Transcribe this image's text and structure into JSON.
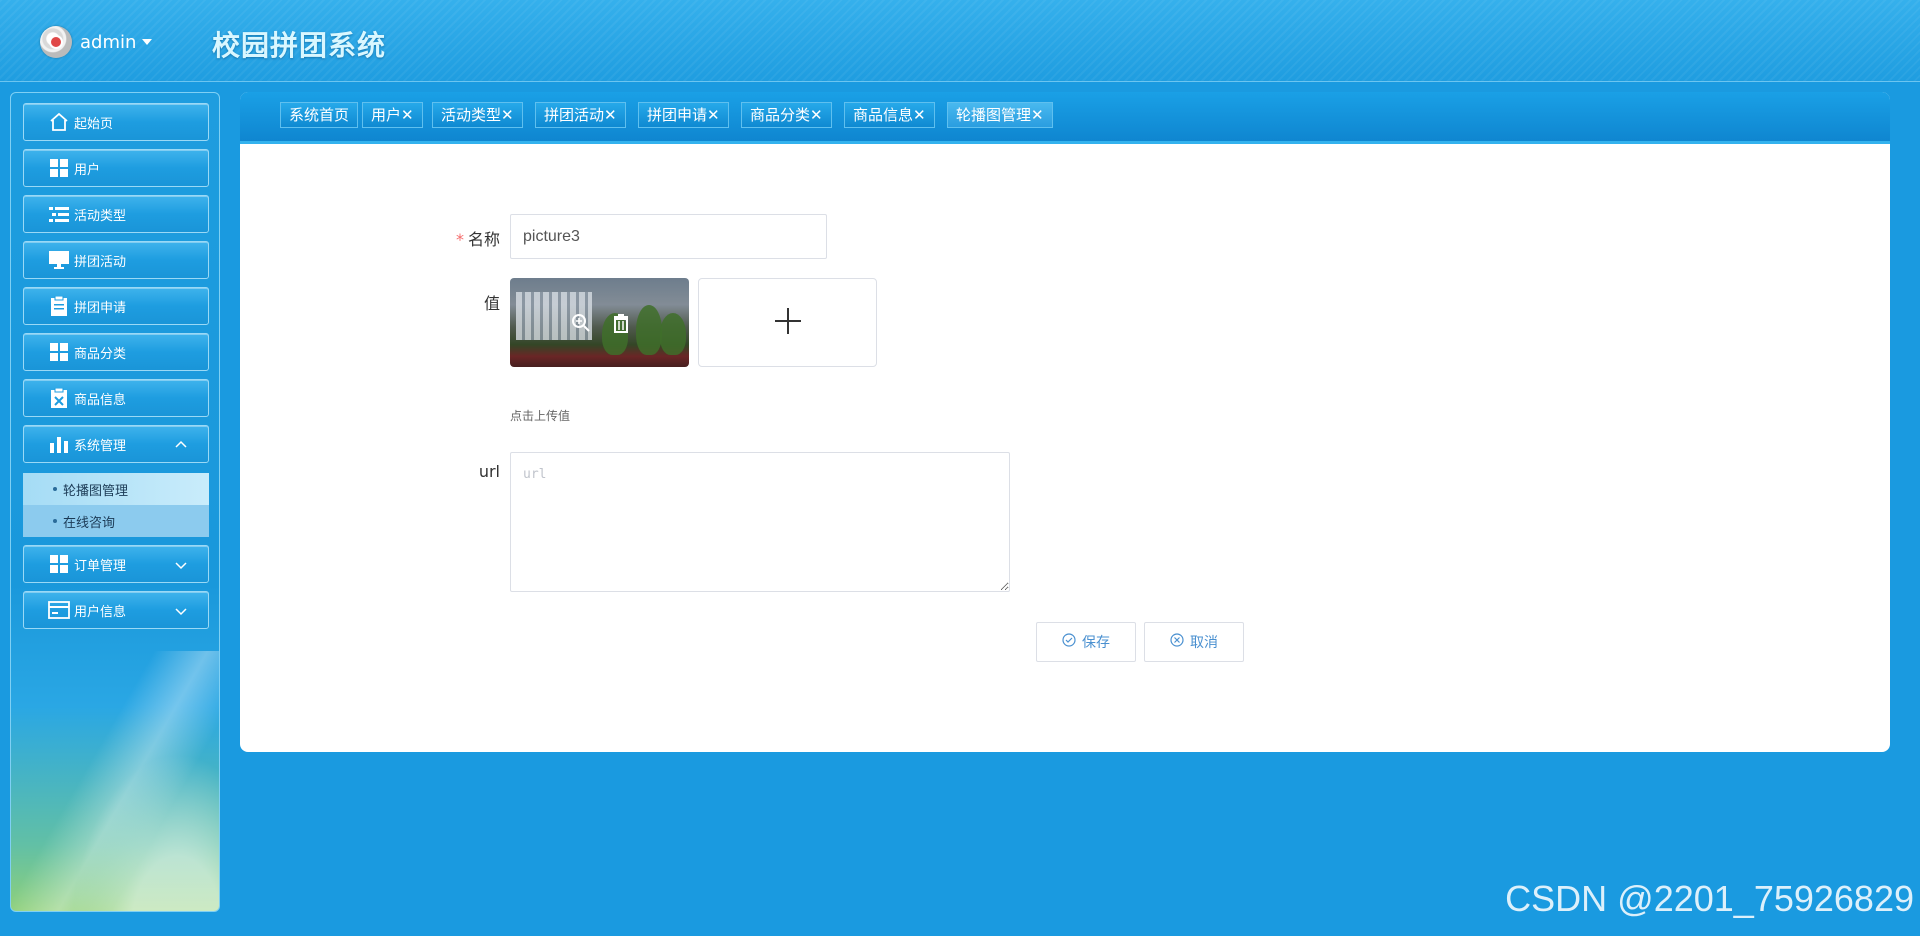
{
  "header": {
    "username": "admin",
    "app_title": "校园拼团系统"
  },
  "sidebar": {
    "items": [
      {
        "label": "起始页",
        "icon": "home-icon"
      },
      {
        "label": "用户",
        "icon": "grid-icon"
      },
      {
        "label": "活动类型",
        "icon": "list-icon"
      },
      {
        "label": "拼团活动",
        "icon": "monitor-icon"
      },
      {
        "label": "拼团申请",
        "icon": "clipboard-icon"
      },
      {
        "label": "商品分类",
        "icon": "grid-icon"
      },
      {
        "label": "商品信息",
        "icon": "clipboard-x-icon"
      },
      {
        "label": "系统管理",
        "icon": "bar-chart-icon"
      },
      {
        "label": "订单管理",
        "icon": "grid-icon"
      },
      {
        "label": "用户信息",
        "icon": "card-icon"
      }
    ],
    "submenu": [
      {
        "label": "轮播图管理",
        "active": true
      },
      {
        "label": "在线咨询",
        "active": false
      }
    ]
  },
  "tabs": [
    {
      "label": "系统首页"
    },
    {
      "label": "用户✕"
    },
    {
      "label": "活动类型✕"
    },
    {
      "label": "拼团活动✕"
    },
    {
      "label": "拼团申请✕"
    },
    {
      "label": "商品分类✕"
    },
    {
      "label": "商品信息✕"
    },
    {
      "label": "轮播图管理✕"
    }
  ],
  "form": {
    "name_label": "名称",
    "name_value": "picture3",
    "value_label": "值",
    "upload_hint": "点击上传值",
    "url_label": "url",
    "url_placeholder": "url",
    "save_label": "保存",
    "cancel_label": "取消"
  },
  "watermark": "CSDN @2201_75926829",
  "colors": {
    "accent": "#1a9ae0",
    "required": "#f56c6c",
    "button_text": "#4a90d0"
  }
}
